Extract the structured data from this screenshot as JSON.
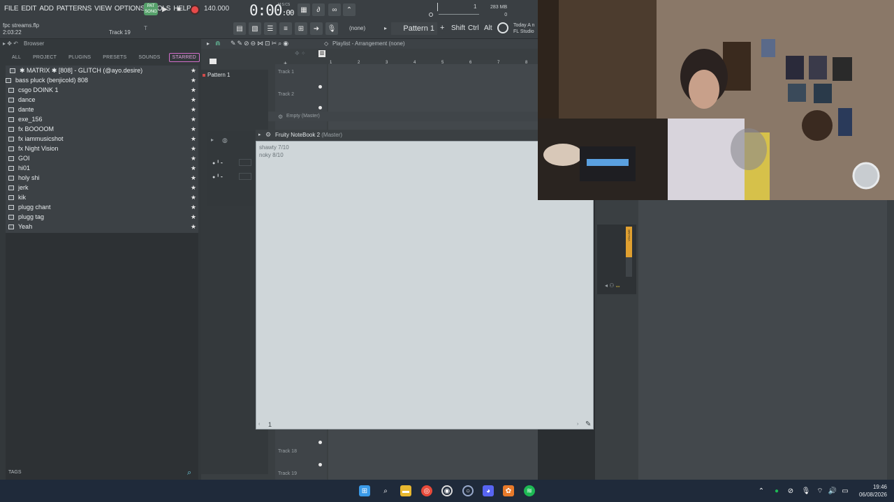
{
  "menu": [
    "FILE",
    "EDIT",
    "ADD",
    "PATTERNS",
    "VIEW",
    "OPTIONS",
    "TOOLS",
    "HELP"
  ],
  "transport": {
    "pat_label": "PAT",
    "song_label": "SONG",
    "tempo": "140.000",
    "time_main": "0:00",
    "time_small": ":00",
    "time_unit": "M:S:CS"
  },
  "file": {
    "name": "fpc streams.flp",
    "time": "2:03:22",
    "track": "Track 19"
  },
  "toolbar": {
    "none_label": "(none)",
    "pattern": "Pattern 1",
    "shift": "Shift",
    "ctrl": "Ctrl",
    "alt": "Alt",
    "memory_top": "1",
    "memory_mb": "283 MB",
    "memory_zero": "0",
    "today": "Today",
    "news": "A n",
    "studio": "FL Studio"
  },
  "browser": {
    "header": "Browser",
    "tabs": [
      "ALL",
      "PROJECT",
      "PLUGINS",
      "PRESETS",
      "SOUNDS",
      "STARRED"
    ],
    "active_tab": "STARRED",
    "items": [
      "✱ MATRIX ✱ [808] - GLITCH (@ayo.desire)",
      "bass pluck (benjicold) 808",
      "csgo DOINK 1",
      "dance",
      "dante",
      "exe_156",
      "fx BOOOOM",
      "fx iammusicshot",
      "fx Night Vision",
      "GOI",
      "hi01",
      "holy shi",
      "jerk",
      "kik",
      "plugg chant",
      "plugg tag",
      "Yeah"
    ],
    "tags_label": "TAGS"
  },
  "playlist": {
    "title": "Playlist - Arrangement",
    "title_none": "(none)",
    "pattern_item": "Pattern 1",
    "tracks": [
      "Track 1",
      "Track 2",
      "Track 18",
      "Track 19"
    ],
    "ruler": [
      "1",
      "2",
      "3",
      "4",
      "5",
      "6",
      "7",
      "8"
    ],
    "empty_bar": "Empty",
    "empty_sub": "(Master)"
  },
  "notebook": {
    "title": "Fruity NoteBook 2",
    "sub": "(Master)",
    "lines": [
      "shawty 7/10",
      "noky 8/10"
    ],
    "page": "1"
  },
  "mixer": {
    "volume_label": "VOLUME"
  },
  "clock": {
    "time": "19:46",
    "date": "06/08/2026"
  },
  "colors": {
    "accent_starred": "#d36ecb",
    "record": "#e84a4a",
    "pat_green": "#55a06a",
    "volume_orange": "#e0a030"
  }
}
